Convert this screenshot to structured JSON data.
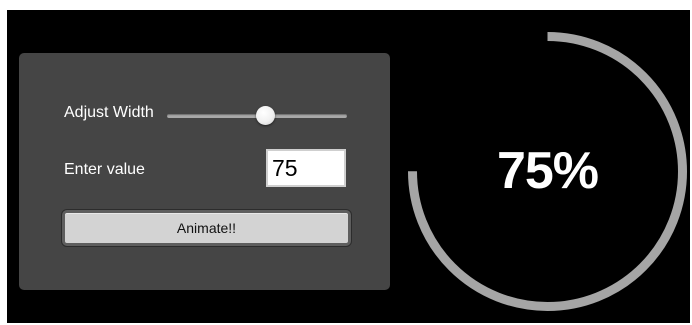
{
  "panel": {
    "width_label": "Adjust Width",
    "value_label": "Enter value",
    "input_value": "75",
    "button_label": "Animate!!",
    "slider_value_fraction": 0.55
  },
  "gauge": {
    "percent": 75,
    "text": "75%",
    "arc_color": "#a5a5a5",
    "text_color": "#ffffff"
  },
  "colors": {
    "background": "#000000",
    "panel": "#454545",
    "button": "#d3d3d3"
  }
}
